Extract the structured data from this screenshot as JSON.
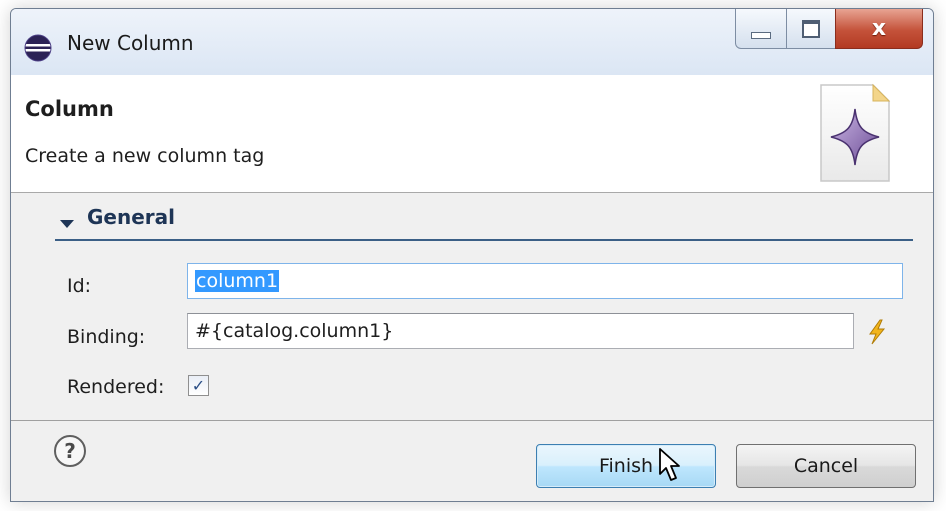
{
  "window": {
    "title": "New Column",
    "close_label": "x"
  },
  "banner": {
    "title": "Column",
    "description": "Create a new column tag"
  },
  "section": {
    "title": "General"
  },
  "fields": {
    "id_label": "Id:",
    "id_value": "column1",
    "binding_label": "Binding:",
    "binding_value": "#{catalog.column1}",
    "rendered_label": "Rendered:",
    "rendered_checked": true
  },
  "buttons": {
    "finish": "Finish",
    "cancel": "Cancel"
  },
  "icons": {
    "app": "eclipse-icon",
    "wizard": "wizard-banner-image",
    "binding": "lightning-icon",
    "help": "help-icon"
  },
  "colors": {
    "selection": "#3399ff",
    "section_rule": "#3b5f86",
    "close_button": "#c4523a",
    "default_button_border": "#3c7fb1"
  }
}
